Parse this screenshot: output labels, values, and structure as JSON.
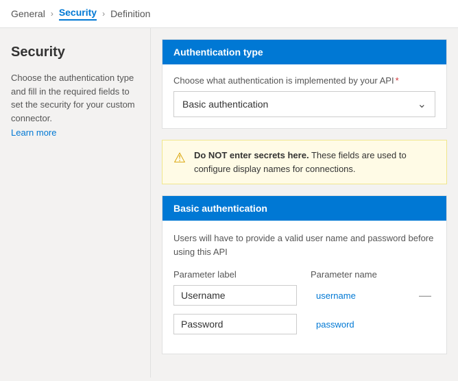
{
  "breadcrumb": {
    "items": [
      {
        "label": "General",
        "active": false
      },
      {
        "label": "Security",
        "active": true
      },
      {
        "label": "Definition",
        "active": false
      }
    ]
  },
  "sidebar": {
    "title": "Security",
    "description_line1": "Choose the authentication type and fill in the required fields to set the security for your custom connector.",
    "learn_more": "Learn more"
  },
  "auth_type_section": {
    "header": "Authentication type",
    "label": "Choose what authentication is implemented by your API",
    "required": "*",
    "selected_value": "Basic authentication",
    "chevron": "⌄"
  },
  "warning": {
    "icon": "⚠",
    "text_strong": "Do NOT enter secrets here.",
    "text_rest": " These fields are used to configure display names for connections."
  },
  "basic_auth_section": {
    "header": "Basic authentication",
    "description": "Users will have to provide a valid user name and password before using this API",
    "col_label": "Parameter label",
    "col_name": "Parameter name",
    "rows": [
      {
        "label": "Username",
        "name": "username"
      },
      {
        "label": "Password",
        "name": "password"
      }
    ]
  }
}
